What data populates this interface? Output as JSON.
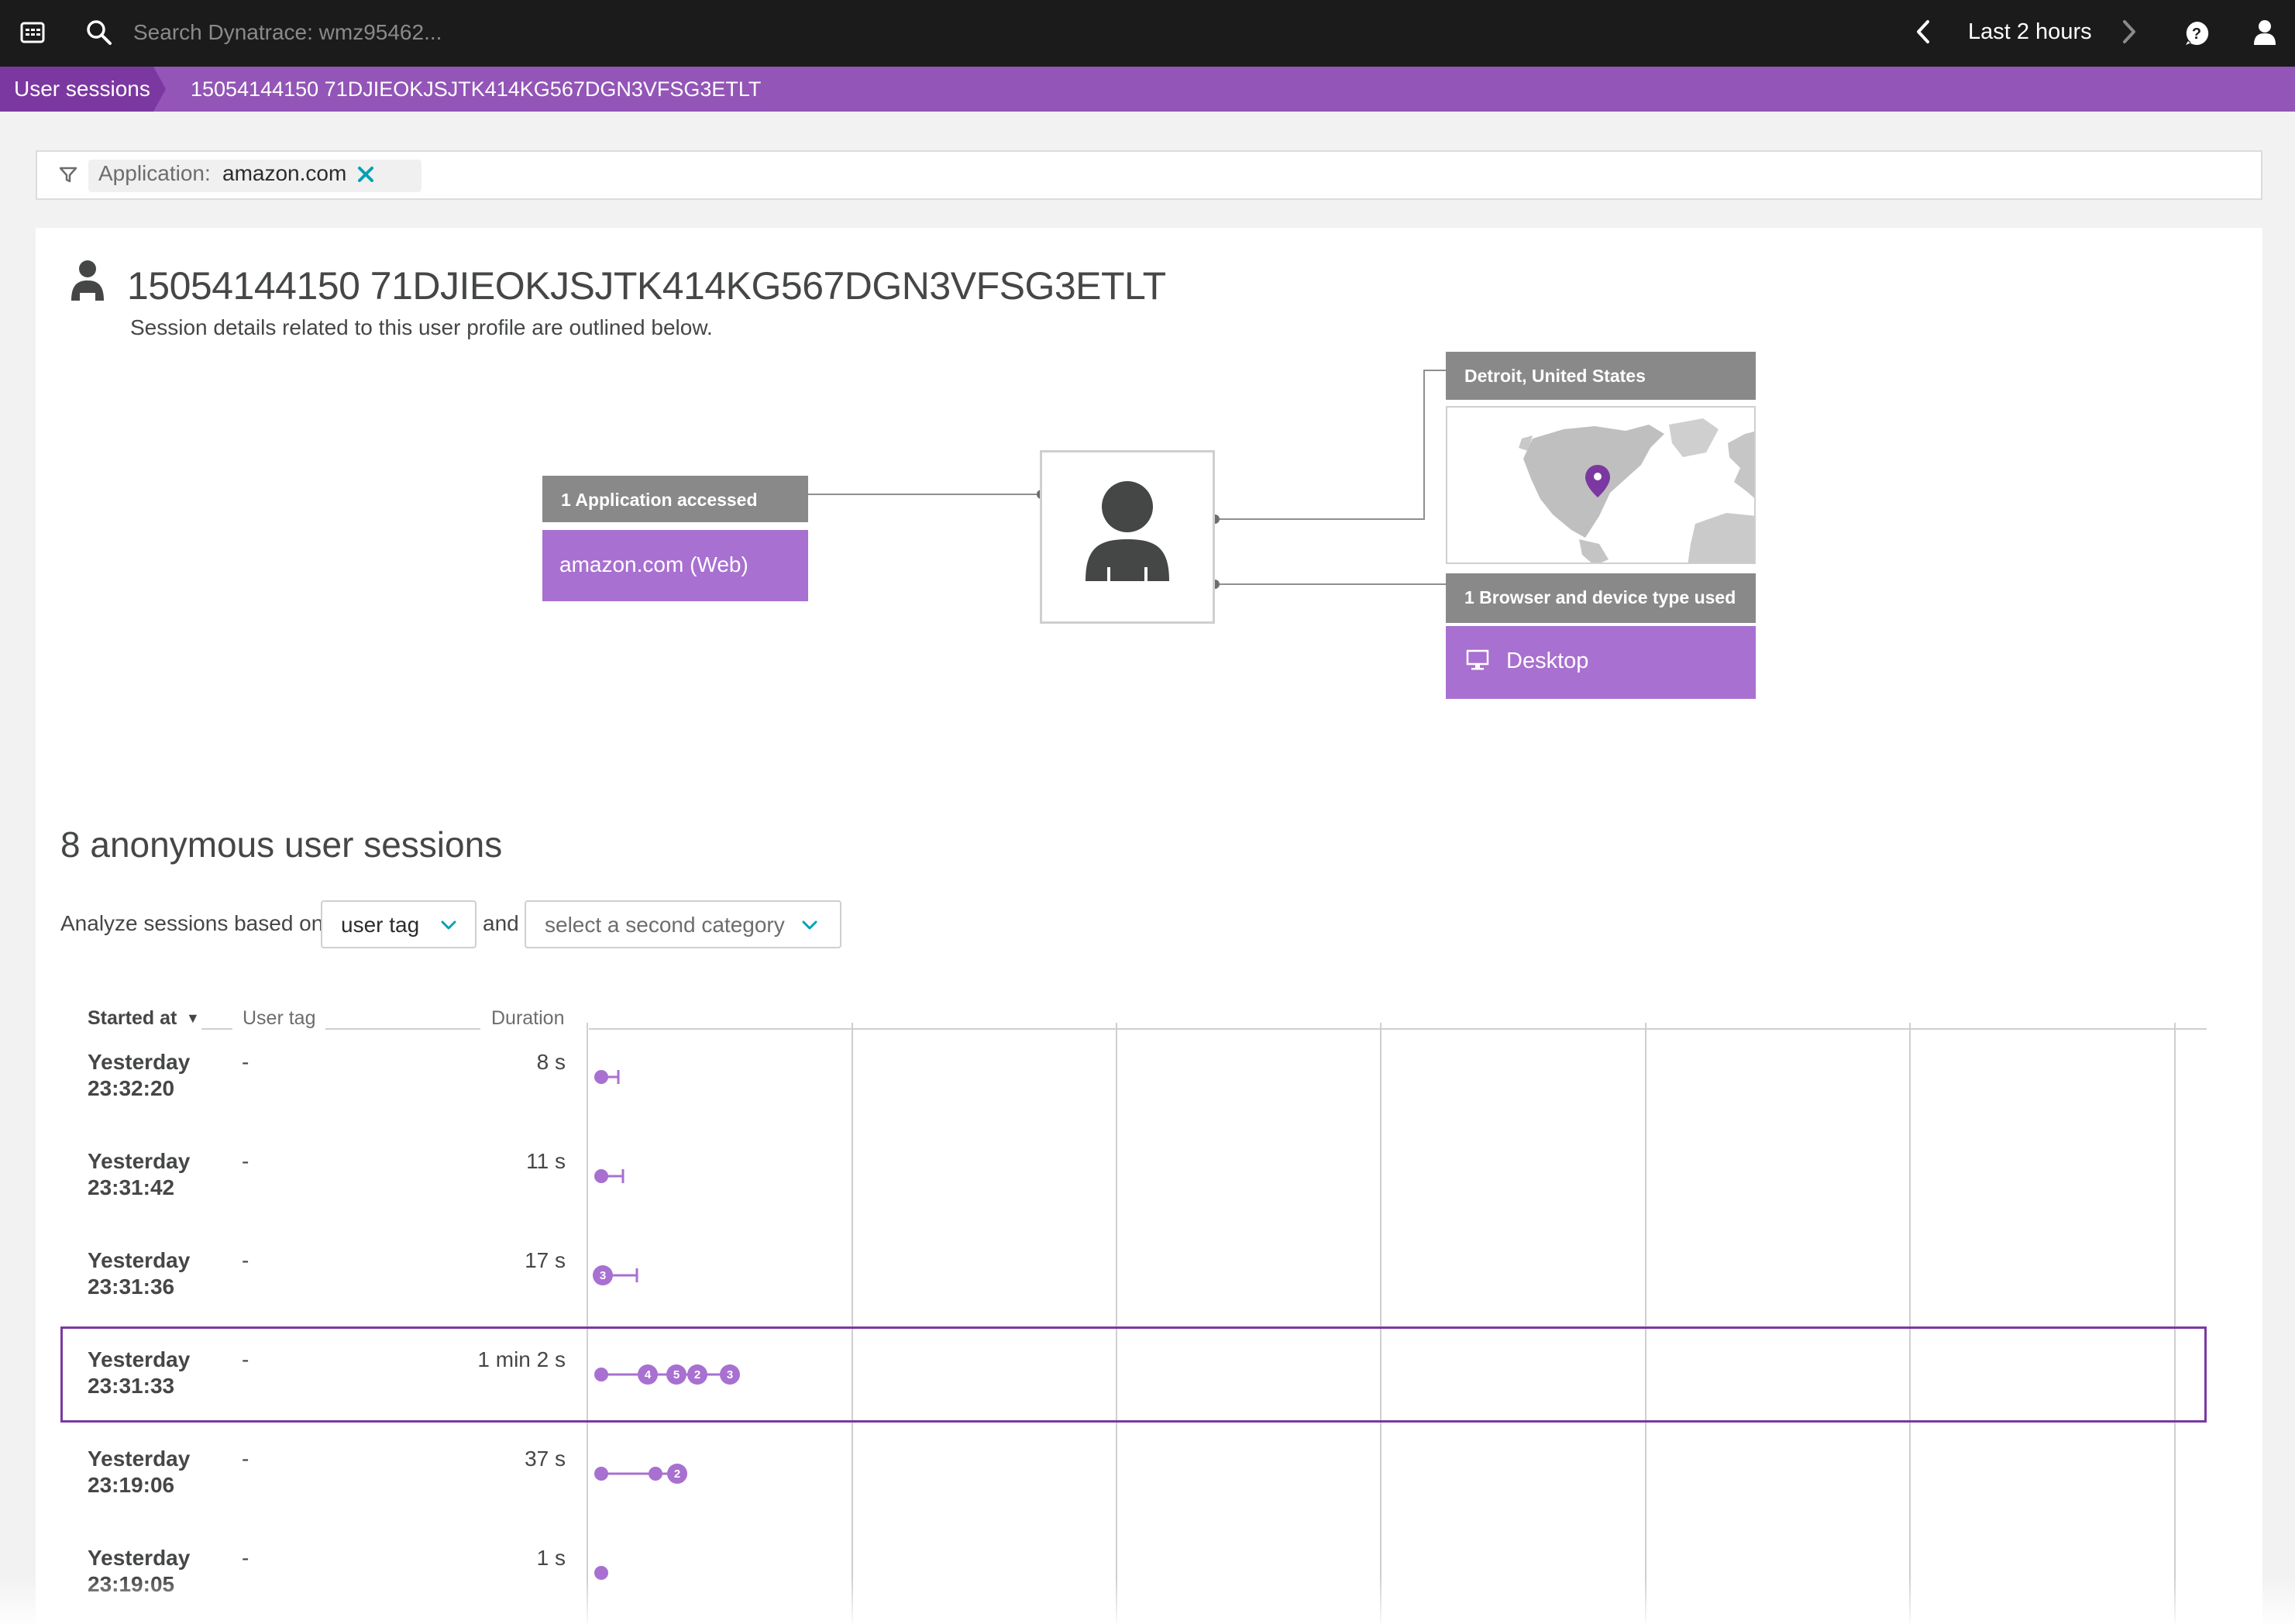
{
  "topbar": {
    "search_placeholder": "Search Dynatrace: wmz95462...",
    "timeframe_label": "Last 2 hours",
    "icons": [
      "menu-icon",
      "search-icon",
      "chevron-left-icon",
      "chevron-right-icon",
      "help-icon",
      "user-icon"
    ]
  },
  "breadcrumb": {
    "items": [
      "User sessions",
      "15054144150 71DJIEOKJSJTK414KG567DGN3VFSG3ETLT"
    ]
  },
  "filter": {
    "key": "Application:",
    "value": "amazon.com"
  },
  "profile": {
    "title": "15054144150 71DJIEOKJSJTK414KG567DGN3VFSG3ETLT",
    "subtitle": "Session details related to this user profile are outlined below."
  },
  "diagram": {
    "apps_header": "1 Application accessed",
    "app_name": "amazon.com (Web)",
    "location_header": "Detroit, United States",
    "device_header": "1 Browser and device type used",
    "device_name": "Desktop"
  },
  "sessions": {
    "title": "8 anonymous user sessions",
    "analyze_label": "Analyze sessions based on",
    "select1_value": "user tag",
    "and_label": "and",
    "select2_placeholder": "select a second category",
    "columns": {
      "started": "Started at",
      "sort_indicator": "▼",
      "tag": "User tag",
      "duration": "Duration"
    },
    "rows": [
      {
        "day": "Yesterday",
        "time": "23:32:20",
        "tag": "-",
        "duration": "8 s",
        "selected": false
      },
      {
        "day": "Yesterday",
        "time": "23:31:42",
        "tag": "-",
        "duration": "11 s",
        "selected": false
      },
      {
        "day": "Yesterday",
        "time": "23:31:36",
        "tag": "-",
        "duration": "17 s",
        "selected": false,
        "badges": [
          "3"
        ]
      },
      {
        "day": "Yesterday",
        "time": "23:31:33",
        "tag": "-",
        "duration": "1 min 2 s",
        "selected": true,
        "badges": [
          "4",
          "5",
          "2",
          "3"
        ]
      },
      {
        "day": "Yesterday",
        "time": "23:19:06",
        "tag": "-",
        "duration": "37 s",
        "selected": false,
        "badges": [
          "2"
        ]
      },
      {
        "day": "Yesterday",
        "time": "23:19:05",
        "tag": "-",
        "duration": "1 s",
        "selected": false
      }
    ]
  },
  "colors": {
    "topbar": "#1b1b1b",
    "breadcrumb": "#9355b7",
    "breadcrumb_active": "#7c38a1",
    "accent_purple": "#a870d0",
    "header_gray": "#898989",
    "filter_close": "#00a1b2"
  }
}
